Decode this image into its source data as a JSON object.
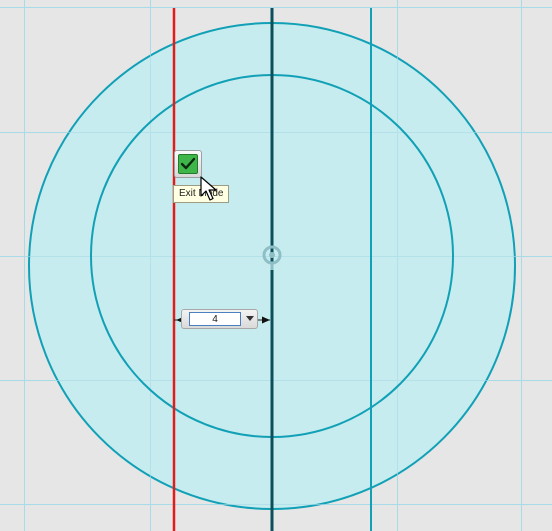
{
  "tooltip": {
    "text": "Exit Mode"
  },
  "dimension_input": {
    "value": "4"
  },
  "icons": {
    "confirm": "checkmark-icon",
    "dropdown": "dropdown-arrow-icon",
    "origin": "origin-marker-icon",
    "cursor": "mouse-pointer-icon"
  },
  "colors": {
    "background": "#e6e6e6",
    "grid_line": "#a8dbe8",
    "circle_fill": "#c6ecef",
    "circle_stroke": "#11a0b6",
    "selected_line": "#e21b1b",
    "axis_line": "#0b4f5a",
    "construction_line": "#11a0b6",
    "confirm_green": "#3fb64a",
    "tooltip_bg": "#ffffe1"
  }
}
